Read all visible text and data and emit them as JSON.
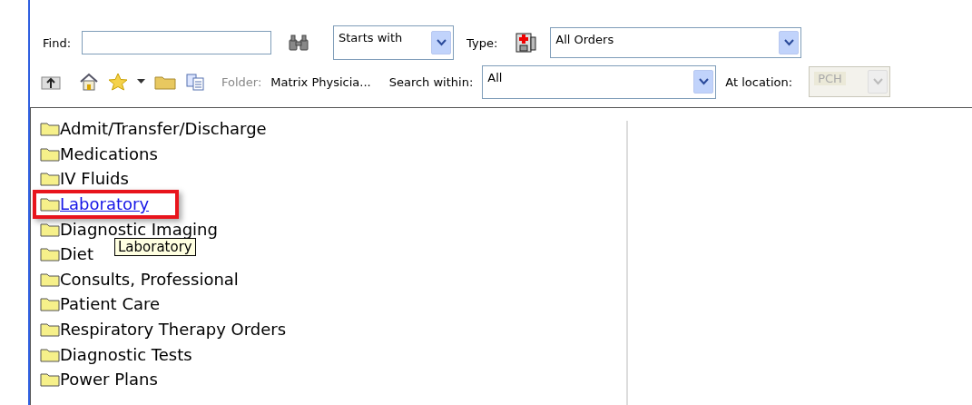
{
  "toolbar": {
    "find_label": "Find:",
    "match": "Starts with",
    "type_label": "Type:",
    "type_value": "All Orders",
    "folder_label": "Folder:",
    "folder_value": "Matrix Physicia...",
    "search_within_label": "Search within:",
    "search_within_value": "All",
    "location_label": "At location:",
    "location_value": "PCH",
    "location_disabled": true
  },
  "folders": [
    {
      "label": "Admit/Transfer/Discharge",
      "hovered": false,
      "highlighted": false
    },
    {
      "label": "Medications",
      "hovered": false,
      "highlighted": false
    },
    {
      "label": "IV Fluids",
      "hovered": false,
      "highlighted": false
    },
    {
      "label": "Laboratory",
      "hovered": true,
      "highlighted": true
    },
    {
      "label": "Diagnostic Imaging",
      "hovered": false,
      "highlighted": false
    },
    {
      "label": "Diet",
      "hovered": false,
      "highlighted": false
    },
    {
      "label": "Consults, Professional",
      "hovered": false,
      "highlighted": false
    },
    {
      "label": "Patient Care",
      "hovered": false,
      "highlighted": false
    },
    {
      "label": "Respiratory Therapy Orders",
      "hovered": false,
      "highlighted": false
    },
    {
      "label": "Diagnostic Tests",
      "hovered": false,
      "highlighted": false
    },
    {
      "label": "Power Plans",
      "hovered": false,
      "highlighted": false
    }
  ],
  "tooltip": "Laboratory"
}
